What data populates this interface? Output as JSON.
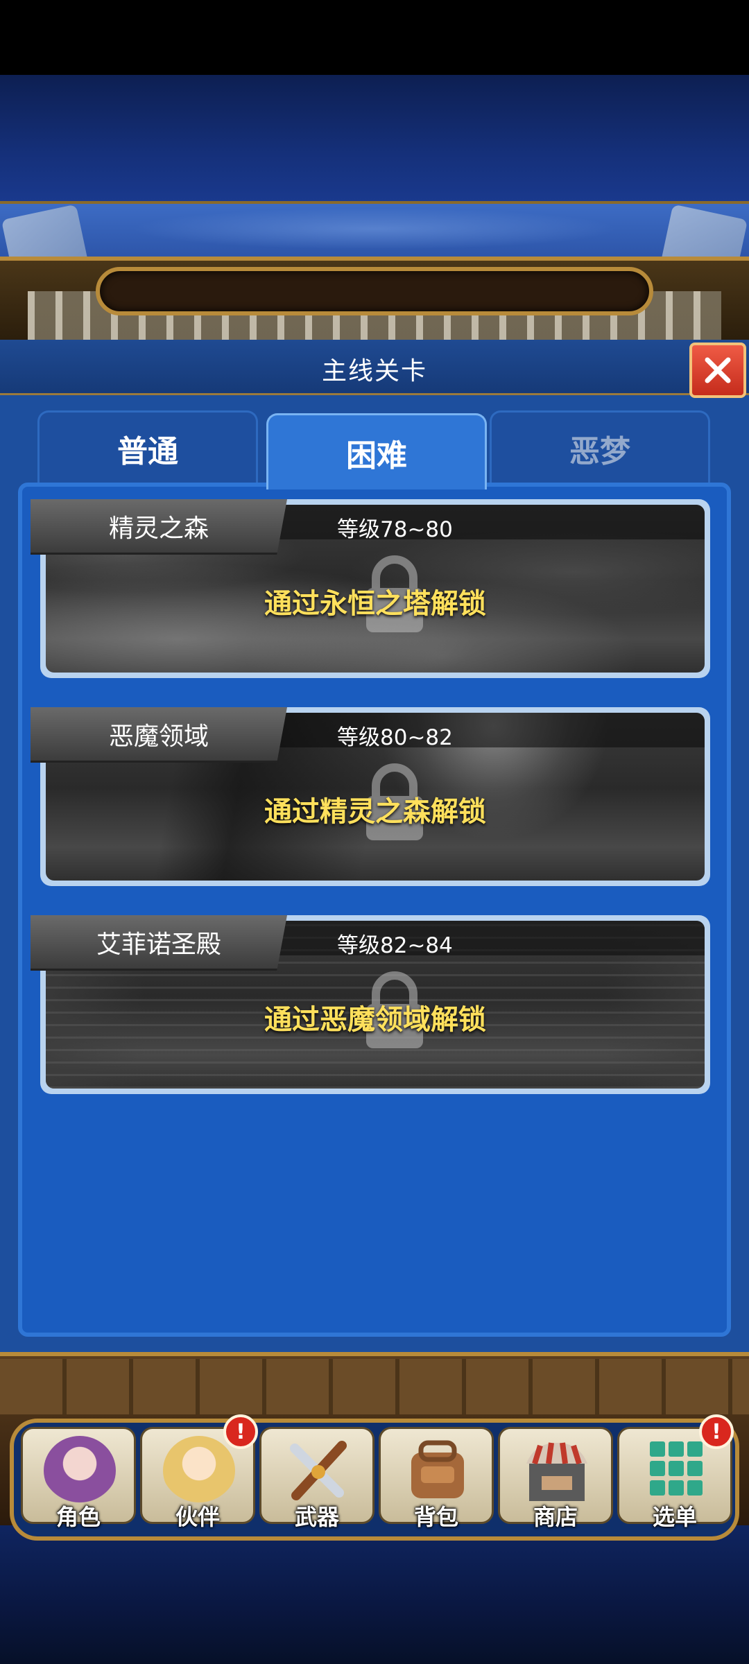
{
  "dialog": {
    "title": "主线关卡",
    "close_icon": "close-icon"
  },
  "tabs": [
    {
      "label": "普通",
      "selected": false
    },
    {
      "label": "困难",
      "selected": true
    },
    {
      "label": "恶梦",
      "selected": false
    }
  ],
  "stages": [
    {
      "name": "精灵之森",
      "level": "等级78~80",
      "unlock_hint": "通过永恒之塔解锁",
      "locked": true
    },
    {
      "name": "恶魔领域",
      "level": "等级80~82",
      "unlock_hint": "通过精灵之森解锁",
      "locked": true
    },
    {
      "name": "艾菲诺圣殿",
      "level": "等级82~84",
      "unlock_hint": "通过恶魔领域解锁",
      "locked": true
    }
  ],
  "nav": [
    {
      "label": "角色",
      "icon": "character-icon",
      "alert": false
    },
    {
      "label": "伙伴",
      "icon": "partner-icon",
      "alert": true
    },
    {
      "label": "武器",
      "icon": "weapon-icon",
      "alert": false
    },
    {
      "label": "背包",
      "icon": "backpack-icon",
      "alert": false
    },
    {
      "label": "商店",
      "icon": "shop-icon",
      "alert": false
    },
    {
      "label": "选单",
      "icon": "menu-grid-icon",
      "alert": true
    }
  ],
  "alert_symbol": "!",
  "colors": {
    "accent_gold": "#b88b3a",
    "panel_blue": "#1a5cbf",
    "unlock_text": "#ffe05c",
    "close_red": "#d9271e"
  }
}
